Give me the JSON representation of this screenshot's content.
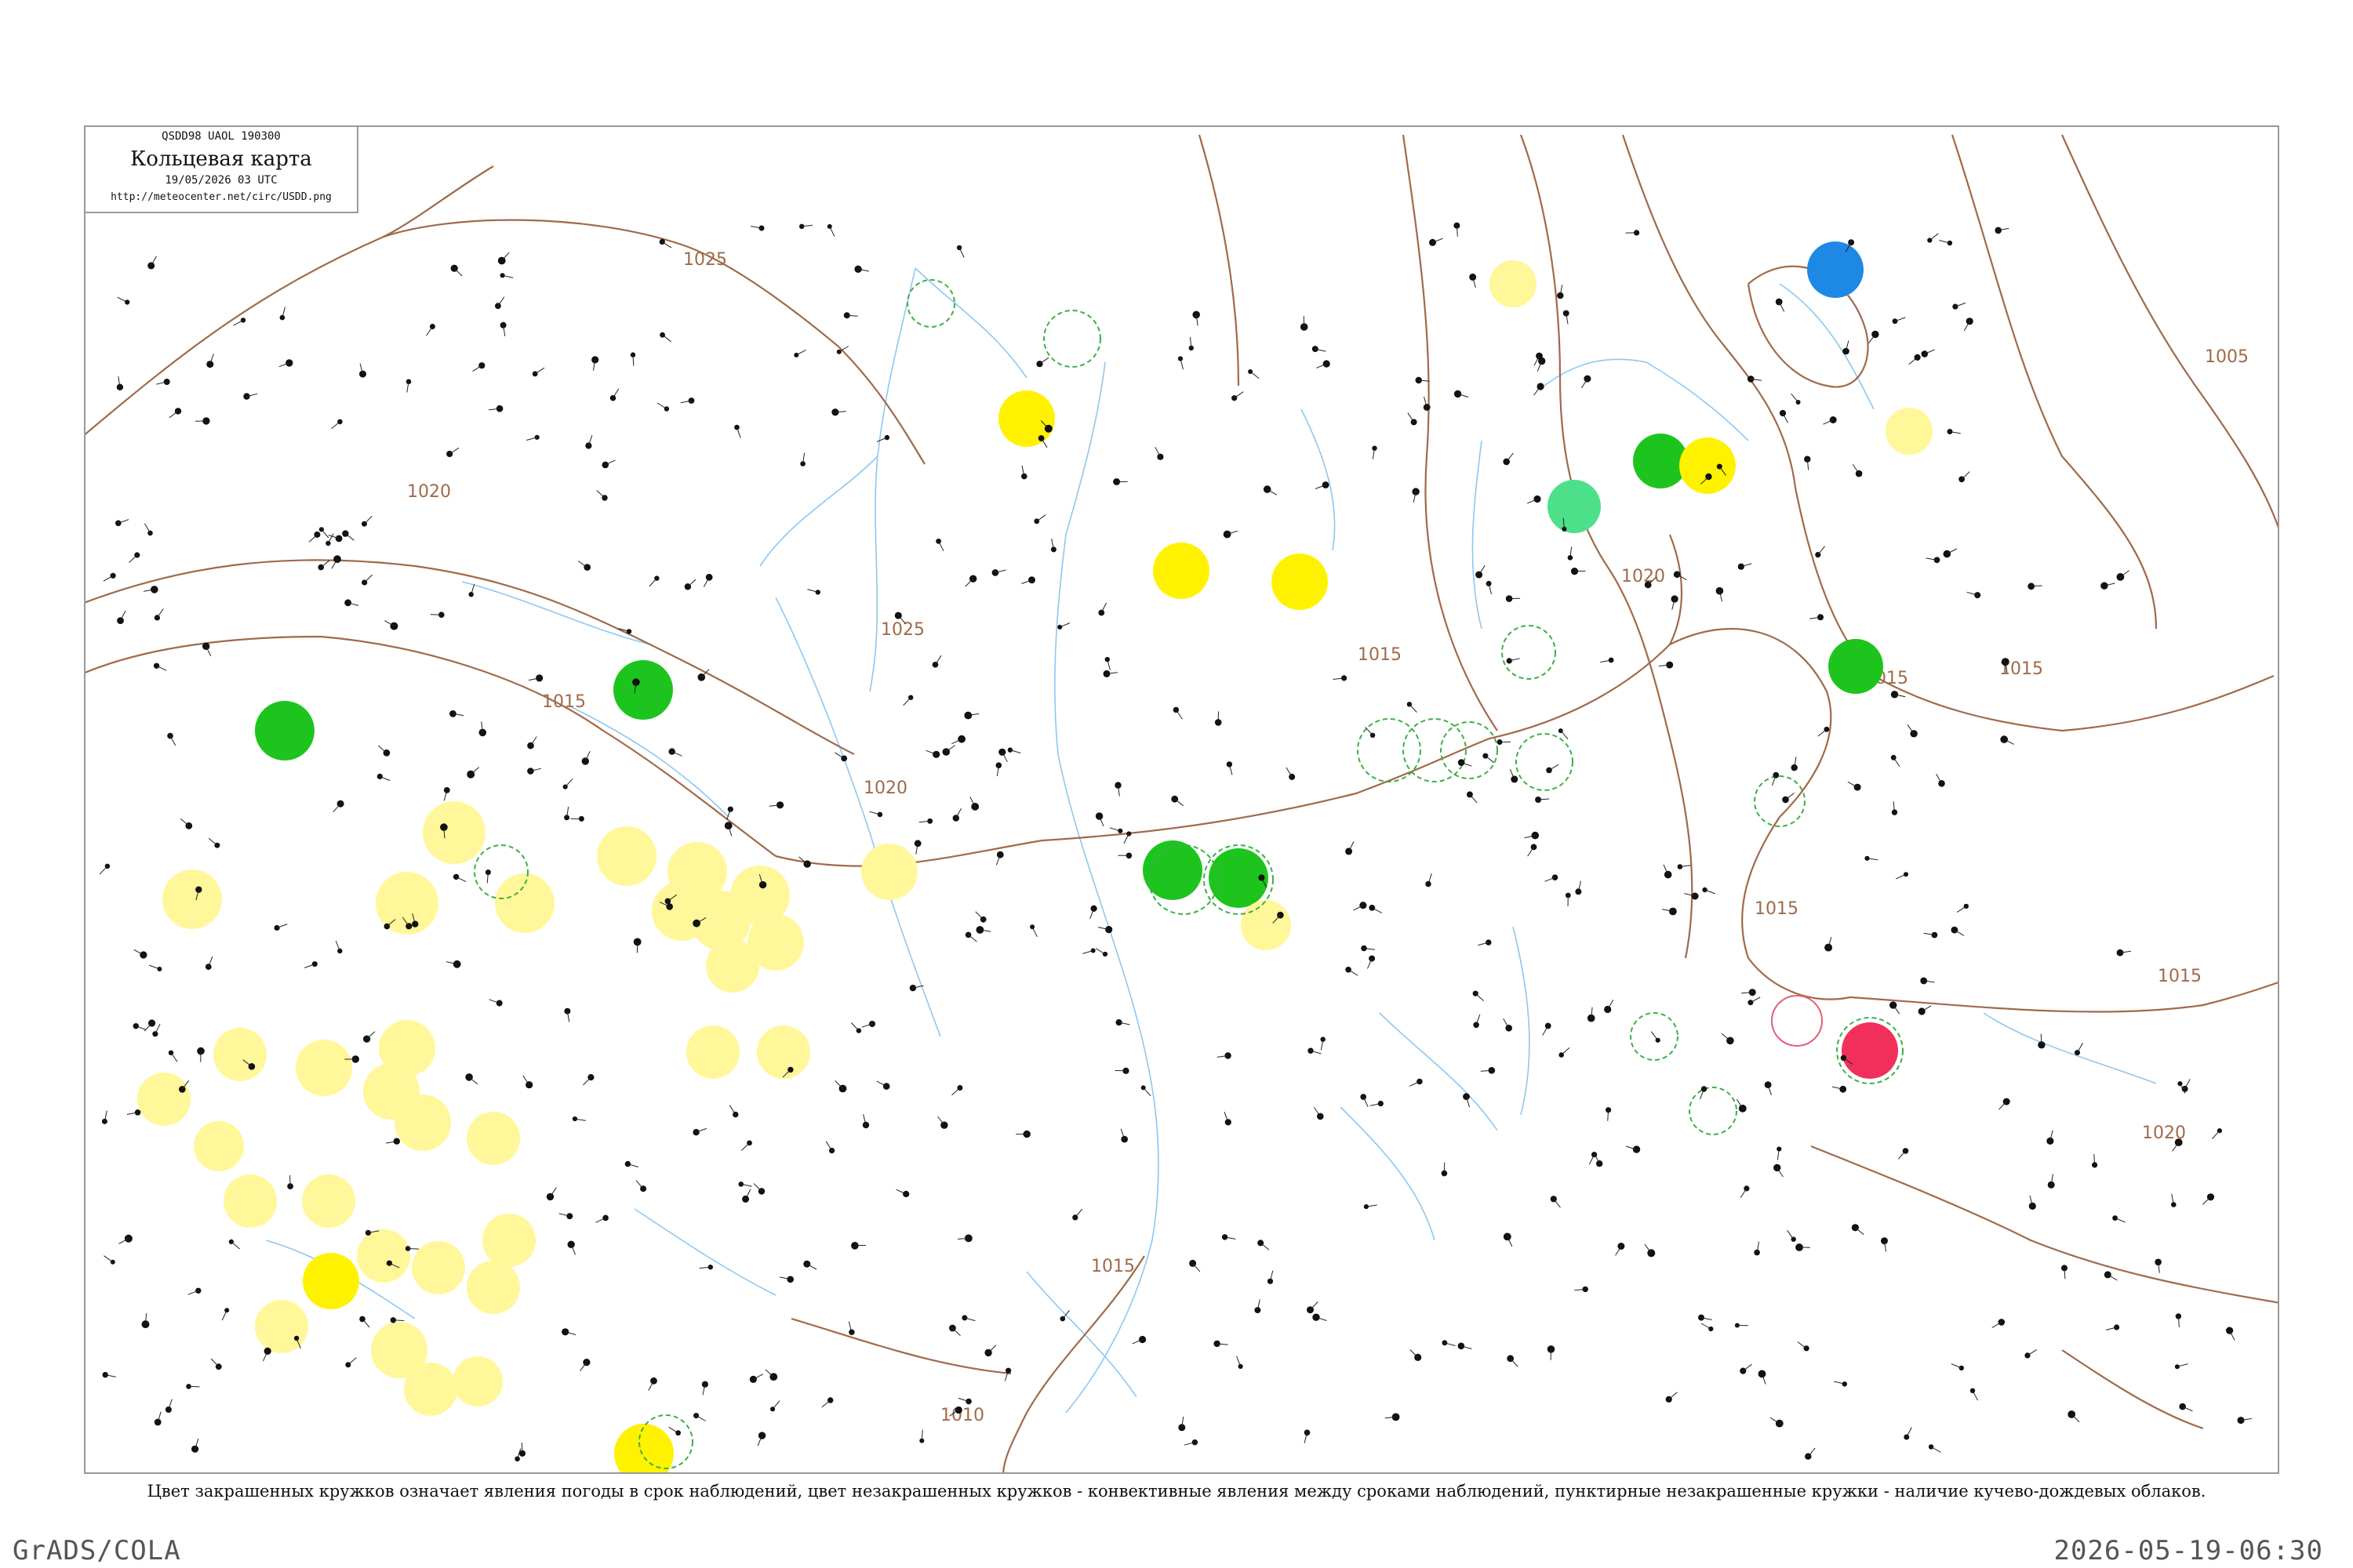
{
  "title": {
    "code": "QSDD98  UAOL  190300",
    "name": "Кольцевая карта",
    "datetime": "19/05/2026 03 UTC",
    "url": "http://meteocenter.net/circ/USDD.png"
  },
  "legend_note": "Цвет закрашенных кружков означает явления погоды в срок наблюдений, цвет незакрашенных кружков - конвективные явления между сроками наблюдений, пунктирные незакрашенные кружки - наличие кучево-дождевых облаков.",
  "footer": {
    "left": "GrADS/COLA",
    "right": "2026-05-19-06:30"
  },
  "isobar_labels": [
    "1025",
    "1020",
    "1015",
    "1025",
    "1020",
    "1015",
    "1015",
    "1010",
    "1020",
    "1015",
    "1015",
    "1015",
    "1005",
    "1020",
    "1015"
  ],
  "colors": {
    "isobar": "#a06a4a",
    "river": "#8ec8f0",
    "green_marker": "#1ec41e",
    "yellow_marker": "#fff200",
    "light_yellow_marker": "#fff799",
    "blue_marker": "#1e88e5",
    "red_marker": "#f0305a",
    "teal_marker": "#4de08a",
    "dashed_cb_circle": "#3cb043",
    "pink_circle": "#e0607a"
  },
  "marker_groups": {
    "filled_green": "filled-green-marker",
    "filled_yellow": "filled-yellow-marker",
    "filled_light_yellow": "filled-light-yellow-marker",
    "filled_blue": "filled-blue-marker",
    "filled_red": "filled-red-marker",
    "dashed_green": "dashed-cb-circle",
    "pink_ring": "convective-ring"
  }
}
